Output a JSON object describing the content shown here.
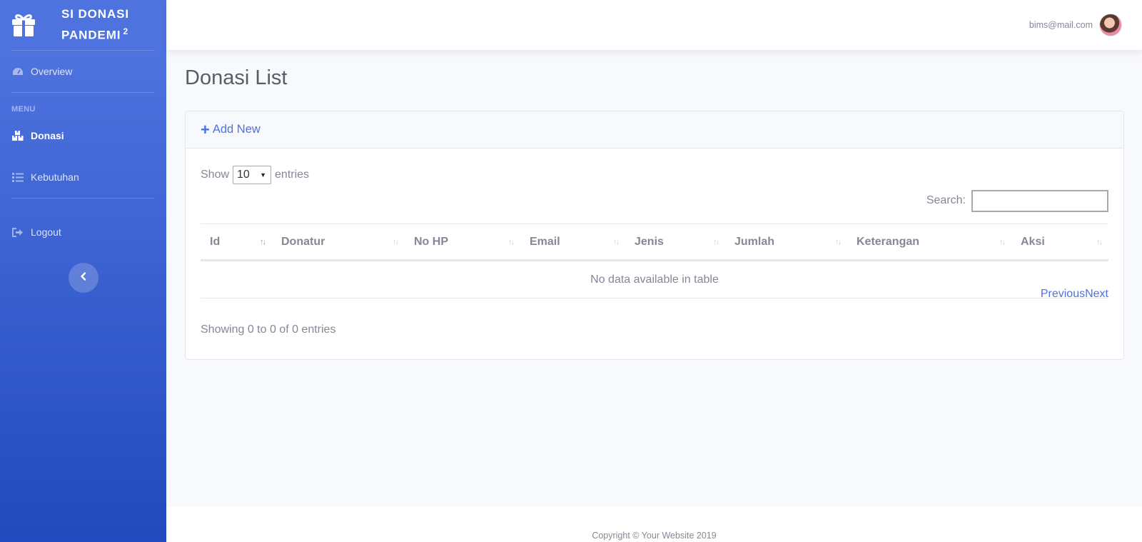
{
  "brand": {
    "line1": "SI DONASI",
    "line2": "PANDEMI",
    "sup": "2",
    "icon": "gift-icon"
  },
  "sidebar": {
    "overview": "Overview",
    "menu_heading": "MENU",
    "donasi": "Donasi",
    "kebutuhan": "Kebutuhan",
    "logout": "Logout"
  },
  "topbar": {
    "user_email": "bims@mail.com"
  },
  "page": {
    "title": "Donasi List",
    "add_new": "Add New"
  },
  "table_controls": {
    "show_label": "Show",
    "entries_value": "10",
    "entries_label": "entries",
    "search_label": "Search:"
  },
  "table": {
    "columns": [
      "Id",
      "Donatur",
      "No HP",
      "Email",
      "Jenis",
      "Jumlah",
      "Keterangan",
      "Aksi"
    ],
    "empty_message": "No data available in table"
  },
  "pagination": {
    "info": "Showing 0 to 0 of 0 entries",
    "previous": "Previous",
    "next": "Next"
  },
  "footer": {
    "copyright": "Copyright © Your Website 2019"
  },
  "colors": {
    "primary": "#4e73df",
    "sidebar_gradient_end": "#224abe",
    "text_muted": "#858796"
  }
}
